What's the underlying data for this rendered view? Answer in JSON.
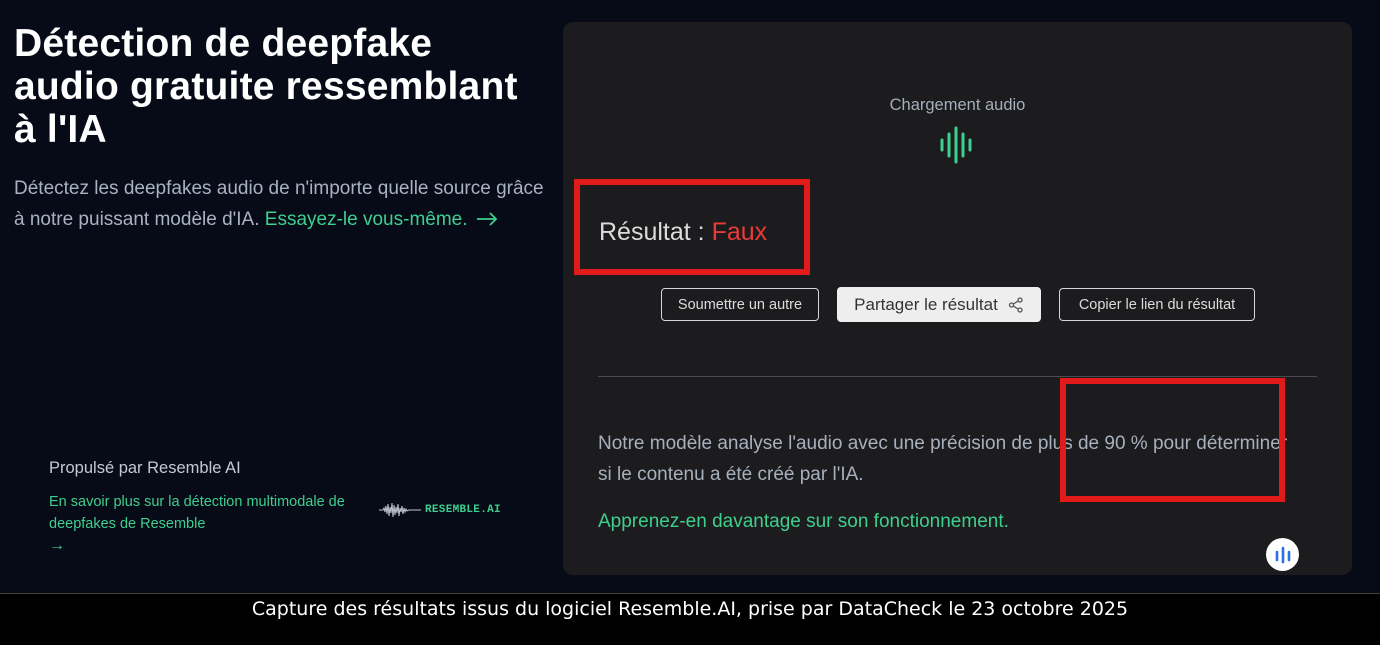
{
  "hero": {
    "title": "Détection de deepfake audio gratuite ressemblant à l'IA",
    "description": "Détectez les deepfakes audio de n'importe quelle source grâce à notre puissant modèle d'IA.",
    "cta": "Essayez-le vous-même.",
    "cta_icon": "arrow-right-icon"
  },
  "powered": {
    "title": "Propulsé par Resemble AI",
    "link": "En savoir plus sur la détection multimodale de deepfakes de Resemble",
    "arrow": "→",
    "brand_name": "RESEMBLE.AI"
  },
  "panel": {
    "loading_label": "Chargement audio",
    "result_label": "Résultat :",
    "result_value": "Faux",
    "result_color": "#ea3a3a",
    "buttons": {
      "submit": "Soumettre un autre",
      "share": "Partager le résultat",
      "copy": "Copier le lien du résultat"
    },
    "info": "Notre modèle analyse l'audio avec une précision de plus de 90 % pour déterminer si le contenu a été créé par l'IA.",
    "learn_more": "Apprenez-en davantage sur son fonctionnement."
  },
  "caption": "Capture des résultats issus du logiciel Resemble.AI, prise par DataCheck le 23 octobre 2025",
  "colors": {
    "accent": "#3ecf8e",
    "highlight": "#e11a1a",
    "background": "#070b17",
    "panel": "#1c1c1e"
  }
}
